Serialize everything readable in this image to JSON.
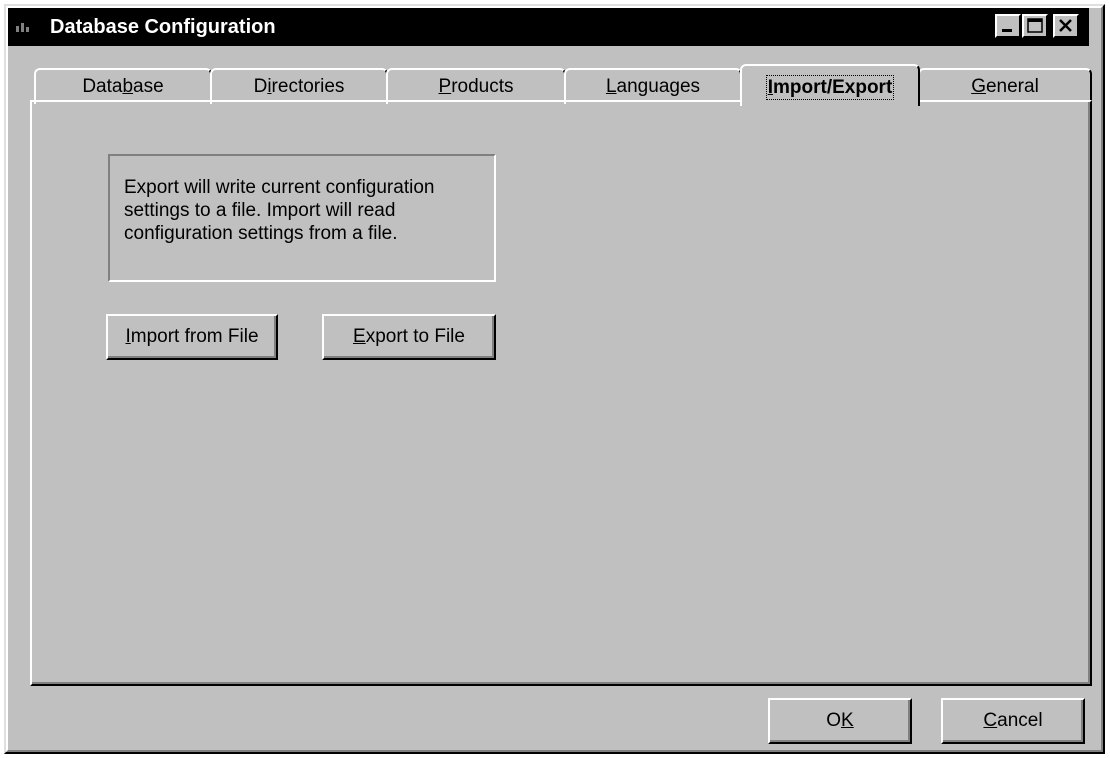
{
  "window": {
    "title": "Database Configuration",
    "controls": {
      "minimize_icon": "minimize-icon",
      "maximize_icon": "maximize-icon",
      "close_icon": "close-icon"
    }
  },
  "tabs": [
    {
      "pre": "Data",
      "u": "b",
      "post": "ase",
      "active": false
    },
    {
      "pre": "D",
      "u": "i",
      "post": "rectories",
      "active": false
    },
    {
      "pre": "",
      "u": "P",
      "post": "roducts",
      "active": false
    },
    {
      "pre": "",
      "u": "L",
      "post": "anguages",
      "active": false
    },
    {
      "pre": "",
      "u": "I",
      "post": "mport/Export",
      "active": true
    },
    {
      "pre": "",
      "u": "G",
      "post": "eneral",
      "active": false
    }
  ],
  "import_export": {
    "description": "Export will write current configuration settings to a file. Import will read configuration settings from a file.",
    "import_button": {
      "u": "I",
      "post": "mport from File"
    },
    "export_button": {
      "u": "E",
      "post": "xport to File"
    }
  },
  "footer": {
    "ok_button": {
      "pre": "O",
      "u": "K",
      "post": ""
    },
    "cancel_button": {
      "pre": "",
      "u": "C",
      "post": "ancel"
    }
  },
  "colors": {
    "face": "#c0c0c0",
    "titlebar": "#000000",
    "highlight": "#ffffff",
    "shadow": "#808080"
  }
}
